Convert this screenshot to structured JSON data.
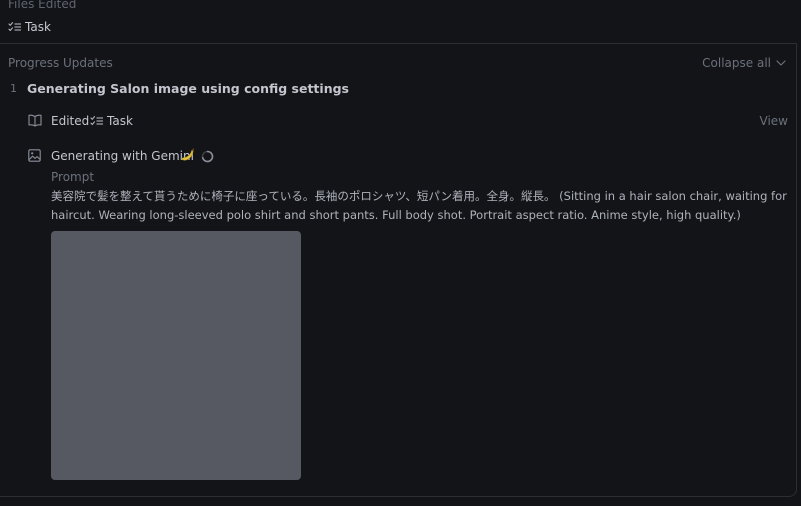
{
  "files_edited": {
    "label": "Files Edited",
    "task_label": "Task"
  },
  "progress": {
    "title": "Progress Updates",
    "collapse_label": "Collapse all",
    "step": {
      "number": "1",
      "title": "Generating Salon image using config settings",
      "edited": {
        "label": "Edited",
        "task_label": "Task",
        "view_label": "View"
      },
      "generating": {
        "label": "Generating with Gemini",
        "emoji": "🍌"
      },
      "prompt_label": "Prompt",
      "prompt_text": "美容院で髪を整えて貰うために椅子に座っている。長袖のポロシャツ、短パン着用。全身。縦長。 (Sitting in a hair salon chair, waiting for haircut. Wearing long-sleeved polo shirt and short pants. Full body shot. Portrait aspect ratio. Anime style, high quality.)"
    }
  },
  "icons": {
    "task": "checklist-icon",
    "edited": "open-book-icon",
    "generating": "image-icon",
    "collapse": "chevron-down-icon",
    "loading": "spinner-icon"
  },
  "colors": {
    "background": "#131418",
    "image_placeholder": "#565961",
    "emoji_fill": "#e8c53a"
  }
}
